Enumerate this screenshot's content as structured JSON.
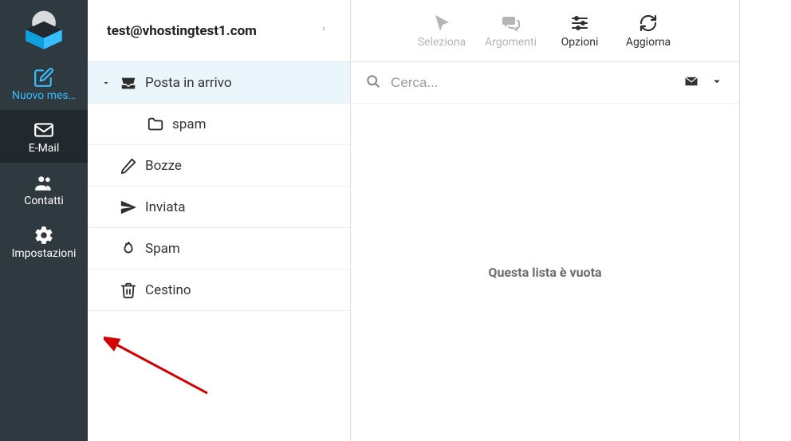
{
  "rail": {
    "compose": "Nuovo mes…",
    "mail": "E-Mail",
    "contacts": "Contatti",
    "settings": "Impostazioni"
  },
  "account": {
    "email": "test@vhostingtest1.com"
  },
  "folders": {
    "inbox": "Posta in arrivo",
    "inbox_spam": "spam",
    "drafts": "Bozze",
    "sent": "Inviata",
    "junk": "Spam",
    "trash": "Cestino"
  },
  "toolbar": {
    "select": "Seleziona",
    "threads": "Argomenti",
    "options": "Opzioni",
    "refresh": "Aggiorna"
  },
  "search": {
    "placeholder": "Cerca..."
  },
  "messages": {
    "empty": "Questa lista è vuota"
  }
}
